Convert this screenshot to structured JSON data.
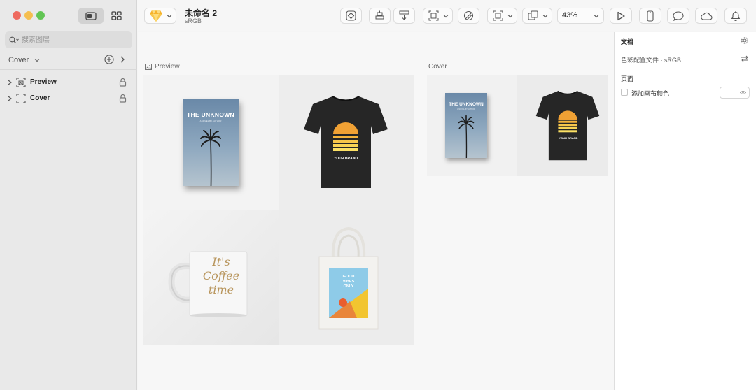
{
  "window": {
    "controls": [
      "close",
      "minimize",
      "zoom"
    ]
  },
  "sidebar": {
    "view_modes": [
      "canvas-view",
      "components-view"
    ],
    "search": {
      "placeholder": "搜索图层",
      "value": ""
    },
    "current_page": "Cover",
    "layers": [
      {
        "name": "Preview",
        "icon": "artboard-image-icon",
        "locked": true
      },
      {
        "name": "Cover",
        "icon": "artboard-icon",
        "locked": true
      }
    ]
  },
  "toolbar": {
    "document_title": "未命名 2",
    "document_subtitle": "sRGB",
    "zoom": "43%",
    "icons": [
      "sketch-logo-icon",
      "symbol-icon",
      "align-bottom-icon",
      "distribute-icon",
      "scale-icon",
      "mask-icon",
      "frame-icon",
      "boolean-icon",
      "preview-play-icon",
      "mirror-icon",
      "comments-icon",
      "cloud-icon",
      "notifications-icon"
    ]
  },
  "canvas": {
    "artboards": [
      {
        "label": "Preview",
        "tiles": [
          {
            "name": "book-mockup",
            "title": "THE UNKNOWN",
            "subtitle": "A NOVEL BY AUTHOR"
          },
          {
            "name": "tshirt-mockup",
            "brand": "YOUR BRAND"
          },
          {
            "name": "mug-mockup",
            "lines": [
              "It's",
              "Coffee",
              "time"
            ]
          },
          {
            "name": "tote-bag-mockup",
            "lines": [
              "GOOD",
              "VIBES",
              "ONLY"
            ]
          }
        ]
      },
      {
        "label": "Cover",
        "tiles": [
          {
            "name": "book-mockup",
            "title": "THE UNKNOWN",
            "subtitle": "A NOVEL BY AUTHOR"
          },
          {
            "name": "tshirt-mockup",
            "brand": "YOUR BRAND"
          }
        ]
      }
    ]
  },
  "inspector": {
    "title": "文档",
    "color_profile": "色彩配置文件 · sRGB",
    "section": "页面",
    "background_checkbox_label": "添加画布颜色",
    "background_checked": false
  },
  "colors": {
    "accent": "#f0a134",
    "tshirt": "#242424",
    "book_sky": "#7f9cb9",
    "sidebar_bg": "#e9e9e9",
    "canvas_bg": "#f7f7f7"
  }
}
